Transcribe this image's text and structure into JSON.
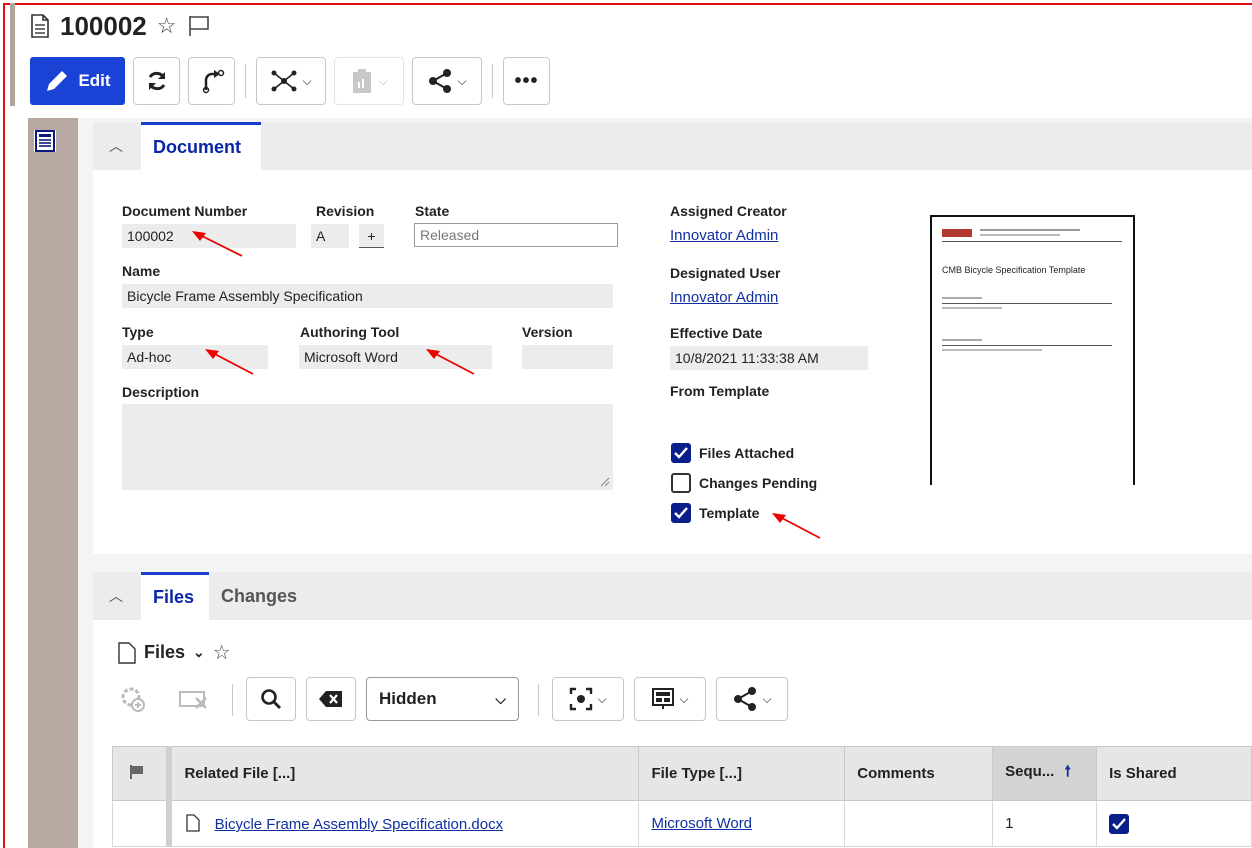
{
  "header": {
    "title": "100002",
    "star_icon": "star-outline-icon",
    "flag_icon": "flag-outline-icon"
  },
  "toolbar": {
    "edit_label": "Edit"
  },
  "document_section": {
    "tab_label": "Document",
    "document_number_label": "Document Number",
    "document_number_value": "100002",
    "revision_label": "Revision",
    "revision_value": "A",
    "revision_plus": "+",
    "state_label": "State",
    "state_value": "Released",
    "name_label": "Name",
    "name_value": "Bicycle Frame Assembly Specification",
    "type_label": "Type",
    "type_value": "Ad-hoc",
    "authoring_tool_label": "Authoring Tool",
    "authoring_tool_value": "Microsoft Word",
    "version_label": "Version",
    "version_value": "",
    "description_label": "Description",
    "description_value": "",
    "assigned_creator_label": "Assigned Creator",
    "assigned_creator_value": "Innovator Admin",
    "designated_user_label": "Designated User",
    "designated_user_value": "Innovator Admin",
    "effective_date_label": "Effective Date",
    "effective_date_value": "10/8/2021 11:33:38 AM",
    "from_template_label": "From Template",
    "checkboxes": [
      {
        "label": "Files Attached",
        "checked": true
      },
      {
        "label": "Changes Pending",
        "checked": false
      },
      {
        "label": "Template",
        "checked": true
      }
    ],
    "preview_title": "CMB Bicycle Specification Template"
  },
  "relationships": {
    "tabs": [
      "Files",
      "Changes"
    ],
    "files_title": "Files",
    "view_select_value": "Hidden",
    "columns": [
      "Related File [...]",
      "File Type [...]",
      "Comments",
      "Sequ...",
      "Is Shared"
    ],
    "rows": [
      {
        "related_file": "Bicycle Frame Assembly Specification.docx",
        "file_type": "Microsoft Word",
        "comments": "",
        "sequence": "1",
        "is_shared": true
      }
    ]
  },
  "colors": {
    "primary": "#1a43d6",
    "link": "#1030a0",
    "annotation_arrow": "#e00000",
    "rail": "#b8a8a2"
  }
}
